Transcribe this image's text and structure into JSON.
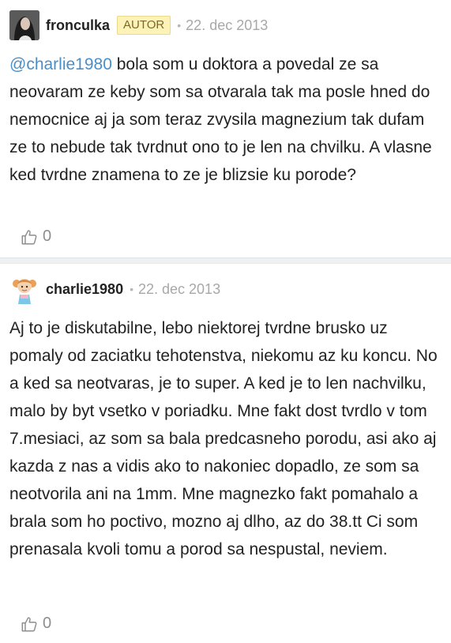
{
  "comments": [
    {
      "author": "fronculka",
      "badge": "AUTOR",
      "separator": "•",
      "date": "22. dec 2013",
      "mention": "@charlie1980",
      "text": " bola som u doktora a povedal ze sa neovaram ze keby som sa otvarala tak ma posle hned do nemocnice aj ja som teraz zvysila magnezium tak dufam ze to nebude tak tvrdnut ono to je len na chvilku. A vlasne ked tvrdne znamena to ze je blizsie ku porode?",
      "likes": "0",
      "avatar_icon": "user-photo-avatar",
      "like_icon": "thumbs-up-icon"
    },
    {
      "author": "charlie1980",
      "separator": "•",
      "date": "22. dec 2013",
      "text": "Aj to je diskutabilne, lebo niektorej tvrdne brusko uz pomaly od zaciatku tehotenstva, niekomu az ku koncu. No a ked sa neotvaras, je to super. A ked je to len nachvilku, malo by byt vsetko v poriadku. Mne fakt dost tvrdlo v tom 7.mesiaci, az som sa bala predcasneho porodu, asi ako aj kazda z nas a vidis ako to nakoniec dopadlo, ze som sa neotvorila ani na 1mm. Mne magnezko fakt pomahalo a brala som ho poctivo, mozno aj dlho, az do 38.tt Ci som prenasala kvoli tomu a porod sa nespustal, neviem.",
      "likes": "0",
      "avatar_icon": "cartoon-girl-avatar",
      "like_icon": "thumbs-up-icon"
    }
  ],
  "colors": {
    "mention": "#4a8fc7",
    "badge_bg": "#fdf3b8",
    "date": "#a8a8a8",
    "separator_bg": "#eef0f2"
  }
}
